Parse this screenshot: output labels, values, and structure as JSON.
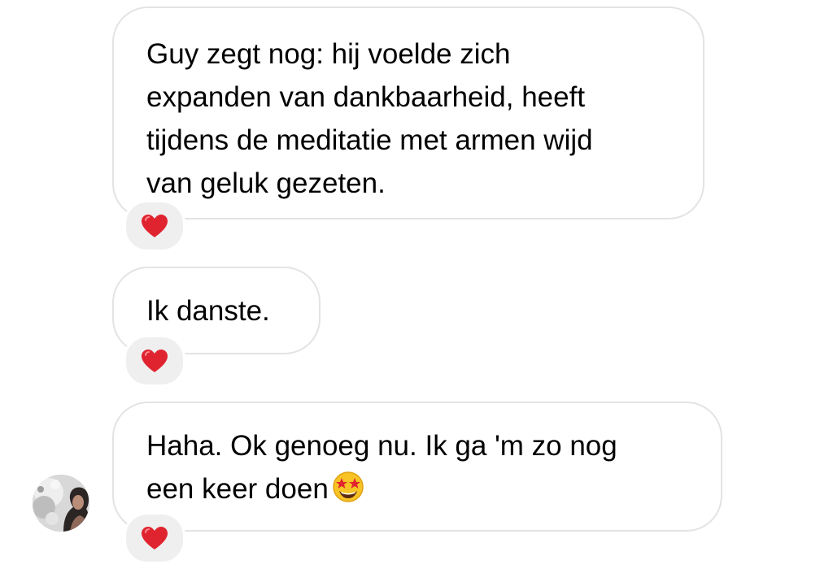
{
  "messages": [
    {
      "text": "Guy zegt nog: hij voelde zich\nexpanden van dankbaarheid, heeft\ntijdens de meditatie met armen wijd\nvan geluk gezeten.",
      "reaction": "heart-icon"
    },
    {
      "text": "Ik danste.",
      "reaction": "heart-icon"
    },
    {
      "text": "Haha. Ok genoeg nu. Ik ga 'm zo nog\neen keer doen",
      "trailing_emoji": "star-struck-emoji-icon",
      "reaction": "heart-icon"
    }
  ],
  "colors": {
    "bubble_border": "#e3e3e3",
    "reaction_bg": "#efefef",
    "heart": "#e0242f"
  }
}
